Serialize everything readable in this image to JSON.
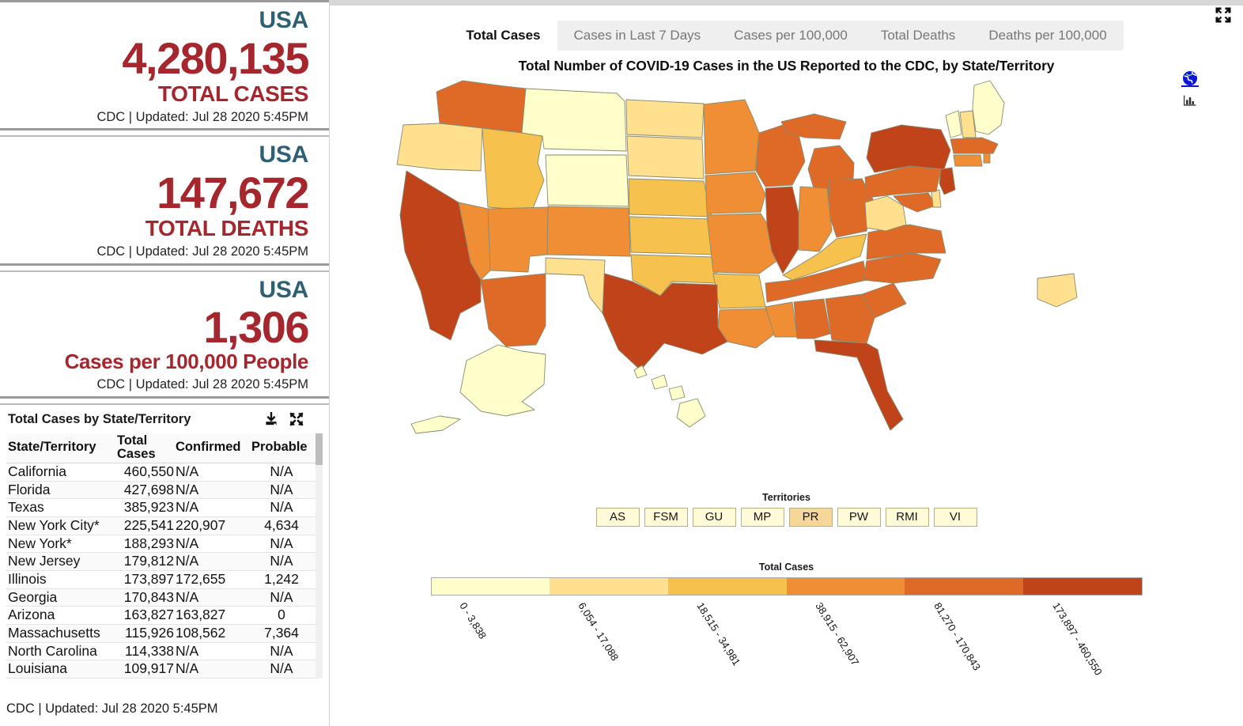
{
  "left": {
    "stats": [
      {
        "geo": "USA",
        "value": "4,280,135",
        "label": "TOTAL CASES",
        "source": "CDC | Updated: Jul 28 2020 5:45PM"
      },
      {
        "geo": "USA",
        "value": "147,672",
        "label": "TOTAL DEATHS",
        "source": "CDC | Updated: Jul 28 2020 5:45PM"
      },
      {
        "geo": "USA",
        "value": "1,306",
        "label": "Cases per 100,000 People",
        "source": "CDC | Updated: Jul 28 2020 5:45PM"
      }
    ],
    "table": {
      "title": "Total Cases by State/Territory",
      "download_icon": "download-icon",
      "expand_icon": "expand-icon",
      "columns": [
        "State/Territory",
        "Total Cases",
        "Confirmed",
        "Probable"
      ],
      "rows": [
        {
          "state": "California",
          "total": "460,550",
          "confirmed": "N/A",
          "probable": "N/A"
        },
        {
          "state": "Florida",
          "total": "427,698",
          "confirmed": "N/A",
          "probable": "N/A"
        },
        {
          "state": "Texas",
          "total": "385,923",
          "confirmed": "N/A",
          "probable": "N/A"
        },
        {
          "state": "New York City*",
          "total": "225,541",
          "confirmed": "220,907",
          "probable": "4,634"
        },
        {
          "state": "New York*",
          "total": "188,293",
          "confirmed": "N/A",
          "probable": "N/A"
        },
        {
          "state": "New Jersey",
          "total": "179,812",
          "confirmed": "N/A",
          "probable": "N/A"
        },
        {
          "state": "Illinois",
          "total": "173,897",
          "confirmed": "172,655",
          "probable": "1,242"
        },
        {
          "state": "Georgia",
          "total": "170,843",
          "confirmed": "N/A",
          "probable": "N/A"
        },
        {
          "state": "Arizona",
          "total": "163,827",
          "confirmed": "163,827",
          "probable": "0"
        },
        {
          "state": "Massachusetts",
          "total": "115,926",
          "confirmed": "108,562",
          "probable": "7,364"
        },
        {
          "state": "North Carolina",
          "total": "114,338",
          "confirmed": "N/A",
          "probable": "N/A"
        },
        {
          "state": "Louisiana",
          "total": "109,917",
          "confirmed": "N/A",
          "probable": "N/A"
        }
      ]
    },
    "footer": "CDC | Updated: Jul 28 2020 5:45PM"
  },
  "right": {
    "tabs": [
      {
        "label": "Total Cases",
        "active": true
      },
      {
        "label": "Cases in Last 7 Days",
        "active": false
      },
      {
        "label": "Cases per 100,000",
        "active": false
      },
      {
        "label": "Total Deaths",
        "active": false
      },
      {
        "label": "Deaths per 100,000",
        "active": false
      }
    ],
    "chart_title": "Total Number of COVID-19 Cases in the US Reported to the CDC, by State/Territory",
    "view_icons": [
      {
        "name": "globe-map-icon",
        "selected": true
      },
      {
        "name": "bar-chart-icon",
        "selected": false
      }
    ],
    "expand_icon": "expand-icon",
    "territories_title": "Territories",
    "territories": [
      {
        "code": "AS",
        "highlighted": false
      },
      {
        "code": "FSM",
        "highlighted": false
      },
      {
        "code": "GU",
        "highlighted": false
      },
      {
        "code": "MP",
        "highlighted": false
      },
      {
        "code": "PR",
        "highlighted": true
      },
      {
        "code": "PW",
        "highlighted": false
      },
      {
        "code": "RMI",
        "highlighted": false
      },
      {
        "code": "VI",
        "highlighted": false
      }
    ],
    "legend": {
      "title": "Total Cases",
      "bins": [
        "0 - 3,838",
        "6,054 - 17,088",
        "18,515 - 34,981",
        "38,915 - 62,907",
        "81,270 - 170,843",
        "173,897 - 460,550"
      ],
      "colors": [
        "#ffffcc",
        "#fee08f",
        "#f7c14e",
        "#f08e35",
        "#df6a28",
        "#c0431a"
      ]
    }
  },
  "chart_data": {
    "type": "heatmap",
    "title": "Total Number of COVID-19 Cases in the US Reported to the CDC, by State/Territory",
    "metric": "Total Cases",
    "legend_bins": [
      "0 - 3,838",
      "6,054 - 17,088",
      "18,515 - 34,981",
      "38,915 - 62,907",
      "81,270 - 170,843",
      "173,897 - 460,550"
    ],
    "legend_colors": [
      "#ffffcc",
      "#fee08f",
      "#f7c14e",
      "#f08e35",
      "#df6a28",
      "#c0431a"
    ],
    "national_totals": {
      "total_cases": 4280135,
      "total_deaths": 147672,
      "cases_per_100000": 1306
    },
    "states": [
      {
        "name": "California",
        "value": 460550,
        "bin": 5
      },
      {
        "name": "Florida",
        "value": 427698,
        "bin": 5
      },
      {
        "name": "Texas",
        "value": 385923,
        "bin": 5
      },
      {
        "name": "New York City*",
        "value": 225541,
        "bin": 5
      },
      {
        "name": "New York*",
        "value": 188293,
        "bin": 5
      },
      {
        "name": "New Jersey",
        "value": 179812,
        "bin": 5
      },
      {
        "name": "Illinois",
        "value": 173897,
        "bin": 5
      },
      {
        "name": "Georgia",
        "value": 170843,
        "bin": 4
      },
      {
        "name": "Arizona",
        "value": 163827,
        "bin": 4
      },
      {
        "name": "Massachusetts",
        "value": 115926,
        "bin": 4
      },
      {
        "name": "North Carolina",
        "value": 114338,
        "bin": 4
      },
      {
        "name": "Louisiana",
        "value": 109917,
        "bin": 4
      }
    ]
  }
}
